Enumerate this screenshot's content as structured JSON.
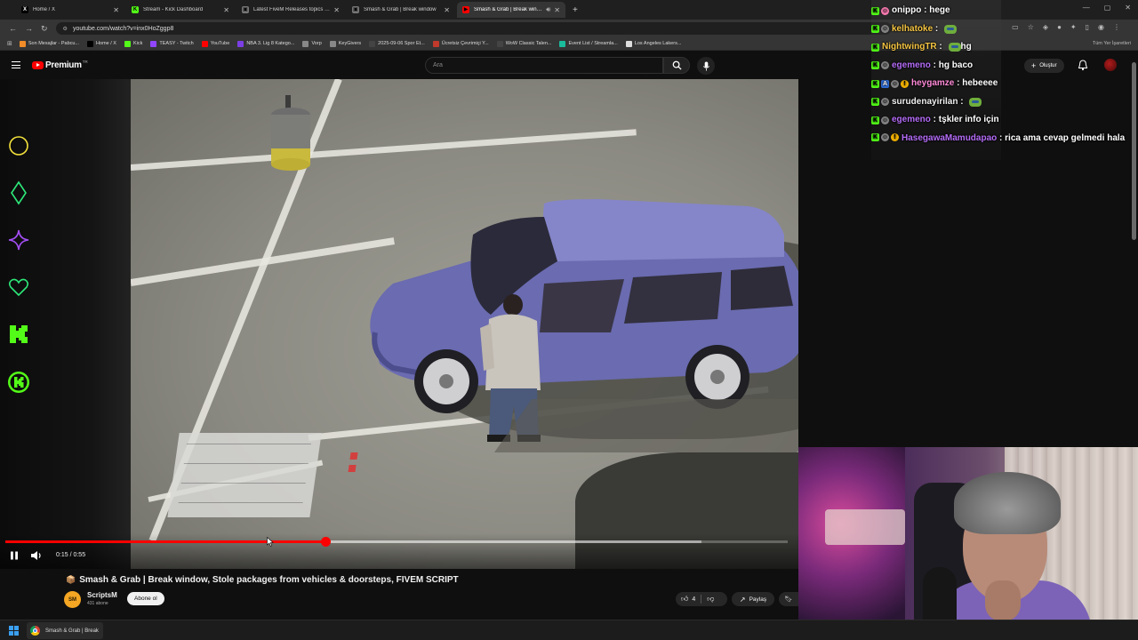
{
  "browser": {
    "tabs": [
      {
        "title": "Home / X",
        "icon": "x-icon",
        "color": "#000000",
        "glyph": "X"
      },
      {
        "title": "Stream - Kick Dashboard",
        "icon": "kick-icon",
        "color": "#53fc18",
        "glyph": "K"
      },
      {
        "title": "Latest FiveM Releases topics - Cfx",
        "icon": "forum-icon",
        "color": "#777777",
        "glyph": "▣"
      },
      {
        "title": "Smash & Grab | Break window",
        "icon": "page-icon",
        "color": "#777777",
        "glyph": "▣"
      },
      {
        "title": "Smash & Grab | Break window",
        "icon": "youtube-icon",
        "color": "#ff0000",
        "glyph": "▶",
        "active": true
      }
    ],
    "url": "youtube.com/watch?v=inx0HoZggp8",
    "bookmarks": [
      {
        "label": "Son Mesajlar - Pabcu...",
        "color": "#f28c28"
      },
      {
        "label": "Home / X",
        "color": "#000000"
      },
      {
        "label": "Kick",
        "color": "#53fc18"
      },
      {
        "label": "TEASY - Twitch",
        "color": "#9146ff"
      },
      {
        "label": "YouTube",
        "color": "#ff0000"
      },
      {
        "label": "NBA 3. Lig 8 Katego...",
        "color": "#7b3fe4"
      },
      {
        "label": "Vorp",
        "color": "#888888"
      },
      {
        "label": "KeyGivers",
        "color": "#888888"
      },
      {
        "label": "2025-09-06 Spor Et...",
        "color": "#444444"
      },
      {
        "label": "Ücretsiz Çevrimiçi Y...",
        "color": "#c0392b"
      },
      {
        "label": "WoW Classic Talen...",
        "color": "#444444"
      },
      {
        "label": "Event List / Streamla...",
        "color": "#1abc9c"
      },
      {
        "label": "Los Angeles Lakers...",
        "color": "#dddddd"
      }
    ],
    "all_bookmarks": "Tüm Yer İşaretleri"
  },
  "youtube": {
    "logo_word": "Premium",
    "country": "TR",
    "search_placeholder": "Ara",
    "create_label": "Oluştur"
  },
  "player": {
    "time": "0:15 / 0:55",
    "progress_fraction": 0.409,
    "buffer_fraction": 0.89
  },
  "video": {
    "title": "Smash & Grab | Break window, Stole packages from vehicles & doorsteps, FIVEM SCRIPT",
    "channel": "ScriptsM",
    "channel_avatar_text": "SM",
    "subscribers": "431 abone",
    "subscribe_label": "Abone ol",
    "likes": "4",
    "share_label": "Paylaş"
  },
  "chat": [
    {
      "user": "onippo",
      "text": "hege",
      "color": "#ffffff",
      "badges": [
        "kick",
        "pink"
      ]
    },
    {
      "user": "kelhatoke",
      "text": "",
      "emote": true,
      "color": "#f5c542",
      "badges": [
        "kick",
        "gray"
      ]
    },
    {
      "user": "NightwingTR",
      "text": "hg",
      "emote": true,
      "color": "#f5c542",
      "badges": [
        "kick"
      ]
    },
    {
      "user": "egemeno",
      "text": "hg baco",
      "color": "#b46cf7",
      "badges": [
        "kick",
        "gray"
      ]
    },
    {
      "user": "heygamze",
      "text": "hebeeee",
      "color": "#ff8ad8",
      "badges": [
        "kick",
        "blue",
        "gray",
        "coin"
      ]
    },
    {
      "user": "surudenayirilan",
      "text": "",
      "emote": true,
      "color": "#f1f1f1",
      "badges": [
        "kick",
        "gray"
      ]
    },
    {
      "user": "egemeno",
      "text": "tşkler info için",
      "color": "#b46cf7",
      "badges": [
        "kick",
        "gray"
      ]
    },
    {
      "user": "HasegawaMamudapao",
      "text": "rica ama cevap gelmedi hala",
      "color": "#b46cf7",
      "badges": [
        "kick",
        "gray",
        "coin"
      ],
      "wrap": true
    }
  ],
  "taskbar": {
    "app_title": "Smash & Grab | Break"
  },
  "colors": {
    "accent_red": "#ff0000",
    "kick_green": "#53fc18"
  }
}
